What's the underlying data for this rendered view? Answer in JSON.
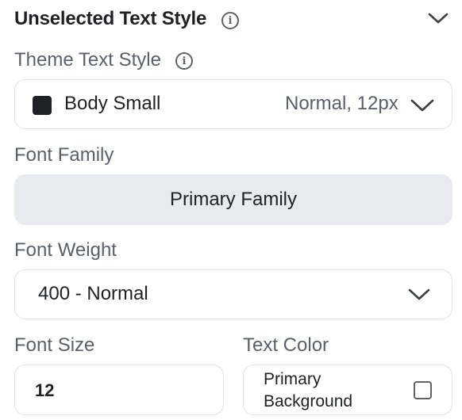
{
  "header": {
    "title": "Unselected Text Style"
  },
  "theme_text_style": {
    "label": "Theme Text Style",
    "name": "Body Small",
    "meta": "Normal, 12px",
    "swatch_color": "#1f2124"
  },
  "font_family": {
    "label": "Font Family",
    "value": "Primary Family"
  },
  "font_weight": {
    "label": "Font Weight",
    "value": "400 - Normal"
  },
  "font_size": {
    "label": "Font Size",
    "value": "12"
  },
  "text_color": {
    "label": "Text Color",
    "line1": "Primary",
    "line2": "Background"
  },
  "icons": [
    "info-icon",
    "chevron-down-icon",
    "checkbox-icon"
  ]
}
